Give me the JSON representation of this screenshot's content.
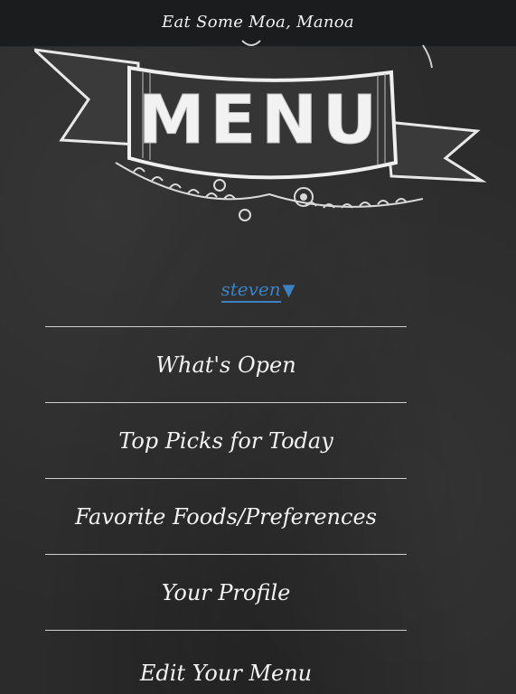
{
  "header": {
    "title": "Eat Some Moa, Manoa"
  },
  "banner": {
    "text": "MENU"
  },
  "user": {
    "name": "steven",
    "caret": "▼"
  },
  "menu": {
    "items": [
      {
        "label": "What's Open"
      },
      {
        "label": "Top Picks for Today"
      },
      {
        "label": "Favorite Foods/Preferences"
      },
      {
        "label": "Your Profile"
      },
      {
        "label": "Edit Your Menu"
      }
    ]
  }
}
